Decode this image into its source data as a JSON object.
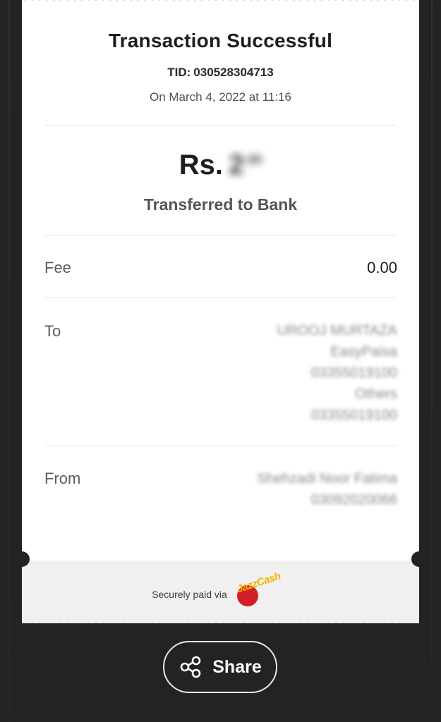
{
  "receipt": {
    "title": "Transaction Successful",
    "tid_label": "TID:",
    "tid_value": "030528304713",
    "date": "On March 4, 2022 at 11:16",
    "currency": "Rs.",
    "amount_blurred": "2",
    "amount_decimals": ".00",
    "type": "Transferred to Bank",
    "fee_label": "Fee",
    "fee_value": "0.00",
    "to_label": "To",
    "to_lines": [
      "UROOJ MURTAZA",
      "EasyPaisa",
      "03355019100",
      "Others",
      "03355019100"
    ],
    "from_label": "From",
    "from_lines": [
      "Shehzadi Noor Fatima",
      "03092020066"
    ]
  },
  "footer": {
    "secure_text": "Securely paid via",
    "logo_text": "JazzCash",
    "logo_colors": {
      "disc": "#d21f26",
      "word": "#f6b300"
    }
  },
  "actions": {
    "share_label": "Share",
    "share_icon": "share-icon"
  }
}
